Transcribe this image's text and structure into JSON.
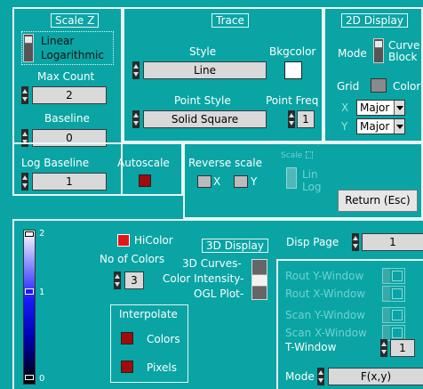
{
  "scale_z": {
    "title": "Scale Z",
    "options": [
      "Linear",
      "Logarithmic"
    ],
    "max_count_label": "Max Count",
    "max_count_value": "2",
    "baseline_label": "Baseline",
    "baseline_value": "0",
    "log_baseline_label": "Log Baseline",
    "log_baseline_value": "1",
    "autoscale_label": "Autoscale"
  },
  "trace": {
    "title": "Trace",
    "style_label": "Style",
    "style_value": "Line",
    "bkgcolor_label": "Bkgcolor",
    "point_style_label": "Point Style",
    "point_style_value": "Solid Square",
    "point_freq_label": "Point Freq",
    "point_freq_value": "1",
    "reverse_scale_label": "Reverse scale",
    "x_label": "X",
    "y_label": "Y",
    "scale_label": "Scale",
    "scale_options": [
      "Lin",
      "Log"
    ]
  },
  "display_2d": {
    "title": "2D Display",
    "mode_label": "Mode",
    "mode_options": [
      "Curve",
      "Block"
    ],
    "grid_label": "Grid",
    "color_label": "Color",
    "x_label": "X",
    "x_value": "Major",
    "y_label": "Y",
    "y_value": "Major"
  },
  "return_button": "Return (Esc)",
  "colorbar": {
    "top_label": "2",
    "mid_label": "1",
    "bottom_label": "0"
  },
  "display_3d": {
    "title": "3D Display",
    "hicolor_label": "HiColor",
    "no_of_colors_label": "No of Colors",
    "no_of_colors_value": "3",
    "curves_label": "3D Curves-",
    "intensity_label": "Color Intensity-",
    "ogl_label": "OGL Plot-",
    "interpolate_title": "Interpolate",
    "colors_label": "Colors",
    "pixels_label": "Pixels"
  },
  "disp_page": {
    "label": "Disp Page",
    "value": "1"
  },
  "windows": {
    "rout_y": "Rout Y-Window",
    "rout_x": "Rout X-Window",
    "scan_y": "Scan Y-Window",
    "scan_x": "Scan X-Window",
    "t_window_label": "T-Window",
    "t_window_value": "1",
    "mode_label": "Mode",
    "mode_value": "F(x,y)"
  }
}
